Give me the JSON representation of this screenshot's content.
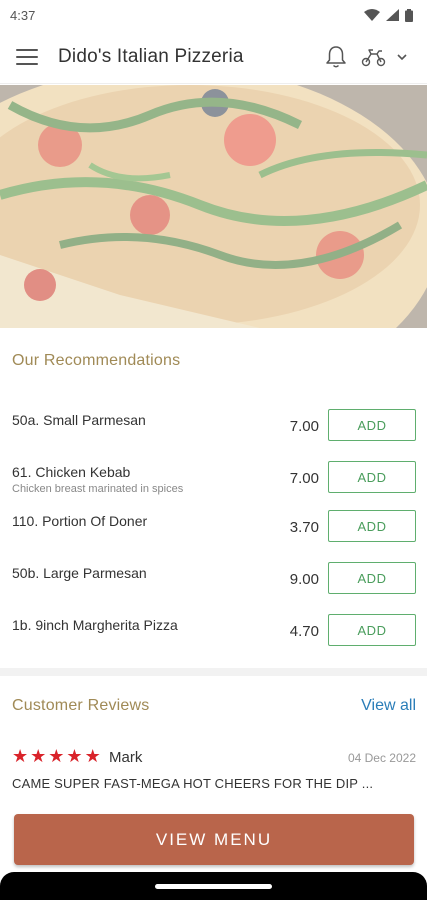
{
  "status_bar": {
    "time": "4:37"
  },
  "app_bar": {
    "title": "Dido's Italian Pizzeria"
  },
  "recommendations": {
    "title": "Our Recommendations",
    "add_label": "ADD",
    "items": [
      {
        "name": "50a. Small Parmesan",
        "description": "",
        "price": "7.00"
      },
      {
        "name": "61. Chicken Kebab",
        "description": "Chicken breast marinated in spices",
        "price": "7.00"
      },
      {
        "name": "110. Portion Of Doner",
        "description": "",
        "price": "3.70"
      },
      {
        "name": "50b. Large Parmesan",
        "description": "",
        "price": "9.00"
      },
      {
        "name": "1b. 9inch Margherita Pizza",
        "description": "",
        "price": "4.70"
      }
    ]
  },
  "reviews": {
    "title": "Customer Reviews",
    "view_all": "View all",
    "items": [
      {
        "rating": 5,
        "reviewer": "Mark",
        "date": "04 Dec 2022",
        "text": "CAME SUPER FAST-MEGA HOT CHEERS FOR THE DIP ..."
      }
    ]
  },
  "cta": {
    "label": "VIEW MENU"
  },
  "colors": {
    "accent": "#b9654b",
    "add_green": "#4a9d5c",
    "section_gold": "#a08a56",
    "link_blue": "#2a7db8",
    "star_red": "#d9232a"
  }
}
